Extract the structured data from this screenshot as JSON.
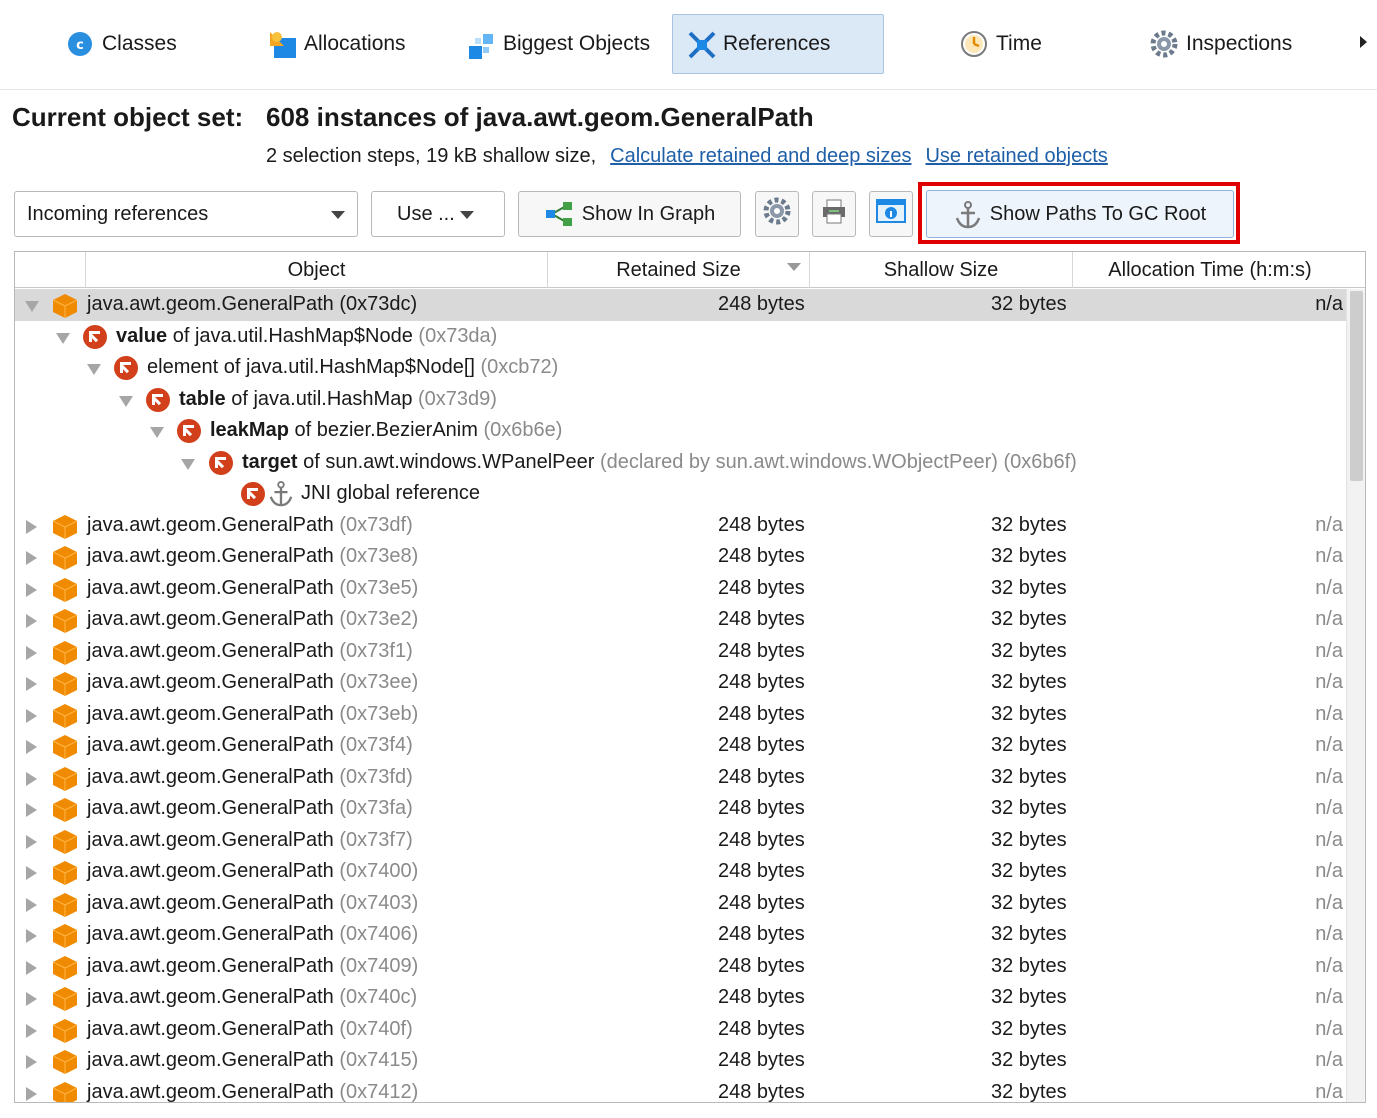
{
  "tabs": [
    {
      "label": "Classes",
      "icon": "classes-icon"
    },
    {
      "label": "Allocations",
      "icon": "allocations-icon"
    },
    {
      "label": "Biggest Objects",
      "icon": "biggest-objects-icon"
    },
    {
      "label": "References",
      "icon": "references-icon",
      "active": true
    },
    {
      "label": "Time",
      "icon": "time-icon"
    },
    {
      "label": "Inspections",
      "icon": "gear-icon"
    }
  ],
  "header": {
    "label": "Current object set:",
    "value": "608 instances of java.awt.geom.GeneralPath",
    "sub": "2 selection steps, 19 kB shallow size,",
    "link1": "Calculate retained and deep sizes",
    "link2": "Use retained objects"
  },
  "toolbar": {
    "view_select": "Incoming references",
    "use_label": "Use ...",
    "graph_label": "Show In Graph",
    "gc_label": "Show Paths To GC Root"
  },
  "columns": {
    "object": "Object",
    "retained": "Retained Size",
    "shallow": "Shallow Size",
    "alloc": "Allocation Time (h:m:s)"
  },
  "tree": [
    {
      "bold": "",
      "text": "java.awt.geom.GeneralPath (0x73dc)",
      "hex": "",
      "retained": "248 bytes",
      "shallow": "32 bytes",
      "alloc": "n/a"
    },
    {
      "bold": "value",
      "text": " of java.util.HashMap$Node ",
      "hex": "(0x73da)"
    },
    {
      "bold": "",
      "text": "element of java.util.HashMap$Node[] ",
      "hex": "(0xcb72)"
    },
    {
      "bold": "table",
      "text": " of java.util.HashMap ",
      "hex": "(0x73d9)"
    },
    {
      "bold": "leakMap",
      "text": " of bezier.BezierAnim ",
      "hex": "(0x6b6e)"
    },
    {
      "bold": "target",
      "text": " of sun.awt.windows.WPanelPeer ",
      "hex": "(declared by sun.awt.windows.WObjectPeer) (0x6b6f)"
    },
    {
      "bold": "",
      "text": "JNI global reference",
      "hex": ""
    }
  ],
  "rows": [
    {
      "name": "java.awt.geom.GeneralPath ",
      "hex": "(0x73df)",
      "retained": "248 bytes",
      "shallow": "32 bytes",
      "alloc": "n/a"
    },
    {
      "name": "java.awt.geom.GeneralPath ",
      "hex": "(0x73e8)",
      "retained": "248 bytes",
      "shallow": "32 bytes",
      "alloc": "n/a"
    },
    {
      "name": "java.awt.geom.GeneralPath ",
      "hex": "(0x73e5)",
      "retained": "248 bytes",
      "shallow": "32 bytes",
      "alloc": "n/a"
    },
    {
      "name": "java.awt.geom.GeneralPath ",
      "hex": "(0x73e2)",
      "retained": "248 bytes",
      "shallow": "32 bytes",
      "alloc": "n/a"
    },
    {
      "name": "java.awt.geom.GeneralPath ",
      "hex": "(0x73f1)",
      "retained": "248 bytes",
      "shallow": "32 bytes",
      "alloc": "n/a"
    },
    {
      "name": "java.awt.geom.GeneralPath ",
      "hex": "(0x73ee)",
      "retained": "248 bytes",
      "shallow": "32 bytes",
      "alloc": "n/a"
    },
    {
      "name": "java.awt.geom.GeneralPath ",
      "hex": "(0x73eb)",
      "retained": "248 bytes",
      "shallow": "32 bytes",
      "alloc": "n/a"
    },
    {
      "name": "java.awt.geom.GeneralPath ",
      "hex": "(0x73f4)",
      "retained": "248 bytes",
      "shallow": "32 bytes",
      "alloc": "n/a"
    },
    {
      "name": "java.awt.geom.GeneralPath ",
      "hex": "(0x73fd)",
      "retained": "248 bytes",
      "shallow": "32 bytes",
      "alloc": "n/a"
    },
    {
      "name": "java.awt.geom.GeneralPath ",
      "hex": "(0x73fa)",
      "retained": "248 bytes",
      "shallow": "32 bytes",
      "alloc": "n/a"
    },
    {
      "name": "java.awt.geom.GeneralPath ",
      "hex": "(0x73f7)",
      "retained": "248 bytes",
      "shallow": "32 bytes",
      "alloc": "n/a"
    },
    {
      "name": "java.awt.geom.GeneralPath ",
      "hex": "(0x7400)",
      "retained": "248 bytes",
      "shallow": "32 bytes",
      "alloc": "n/a"
    },
    {
      "name": "java.awt.geom.GeneralPath ",
      "hex": "(0x7403)",
      "retained": "248 bytes",
      "shallow": "32 bytes",
      "alloc": "n/a"
    },
    {
      "name": "java.awt.geom.GeneralPath ",
      "hex": "(0x7406)",
      "retained": "248 bytes",
      "shallow": "32 bytes",
      "alloc": "n/a"
    },
    {
      "name": "java.awt.geom.GeneralPath ",
      "hex": "(0x7409)",
      "retained": "248 bytes",
      "shallow": "32 bytes",
      "alloc": "n/a"
    },
    {
      "name": "java.awt.geom.GeneralPath ",
      "hex": "(0x740c)",
      "retained": "248 bytes",
      "shallow": "32 bytes",
      "alloc": "n/a"
    },
    {
      "name": "java.awt.geom.GeneralPath ",
      "hex": "(0x740f)",
      "retained": "248 bytes",
      "shallow": "32 bytes",
      "alloc": "n/a"
    },
    {
      "name": "java.awt.geom.GeneralPath ",
      "hex": "(0x7415)",
      "retained": "248 bytes",
      "shallow": "32 bytes",
      "alloc": "n/a"
    },
    {
      "name": "java.awt.geom.GeneralPath ",
      "hex": "(0x7412)",
      "retained": "248 bytes",
      "shallow": "32 bytes",
      "alloc": "n/a"
    }
  ],
  "colors": {
    "accent": "#1f5fa8",
    "highlight": "#e00000",
    "cube": "#f08a00",
    "ref_icon": "#d1401a"
  }
}
